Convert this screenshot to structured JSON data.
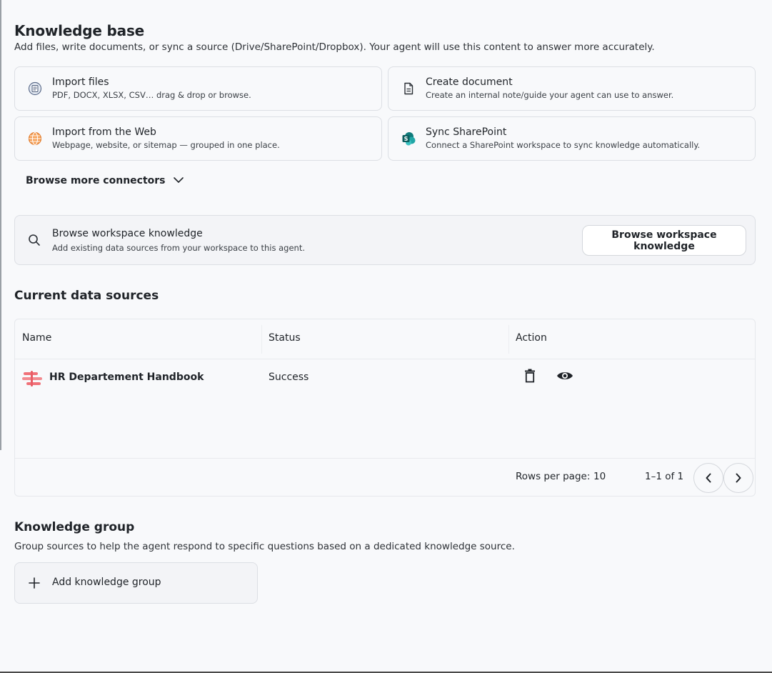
{
  "knowledge_base": {
    "title": "Knowledge base",
    "subtitle": "Add files, write documents, or sync a source (Drive/SharePoint/Dropbox). Your agent will use this content to answer more accurately.",
    "cards": [
      {
        "title": "Import files",
        "subtitle": "PDF, DOCX, XLSX, CSV… drag & drop or browse.",
        "icon": "import-files-icon"
      },
      {
        "title": "Create document",
        "subtitle": "Create an internal note/guide your agent can use to answer.",
        "icon": "document-icon"
      },
      {
        "title": "Import from the Web",
        "subtitle": "Webpage, website, or sitemap — grouped in one place.",
        "icon": "globe-icon"
      },
      {
        "title": "Sync SharePoint",
        "subtitle": "Connect a SharePoint workspace to sync knowledge automatically.",
        "icon": "sharepoint-icon"
      }
    ],
    "browse_more": "Browse more connectors"
  },
  "workspace": {
    "title": "Browse workspace knowledge",
    "subtitle": "Add existing data sources from your workspace to this agent.",
    "button_label": "Browse workspace knowledge"
  },
  "data_sources": {
    "title": "Current data sources",
    "columns": [
      "Name",
      "Status",
      "Action"
    ],
    "rows": [
      {
        "name": "HR Departement Handbook",
        "status": "Success"
      }
    ],
    "footer": {
      "rows_per_page_label": "Rows per page:",
      "rows_per_page_value": "10",
      "range": "1–1 of 1"
    }
  },
  "knowledge_group": {
    "title": "Knowledge group",
    "subtitle": "Group sources to help the agent respond to specific questions based on a dedicated knowledge source.",
    "add_label": "Add knowledge group"
  },
  "colors": {
    "background": "#f8f9fb",
    "border": "#dcdfe4",
    "web_icon": "#f0883e",
    "sharepoint": "#138a8a",
    "handbook_icon": "#f07178"
  }
}
